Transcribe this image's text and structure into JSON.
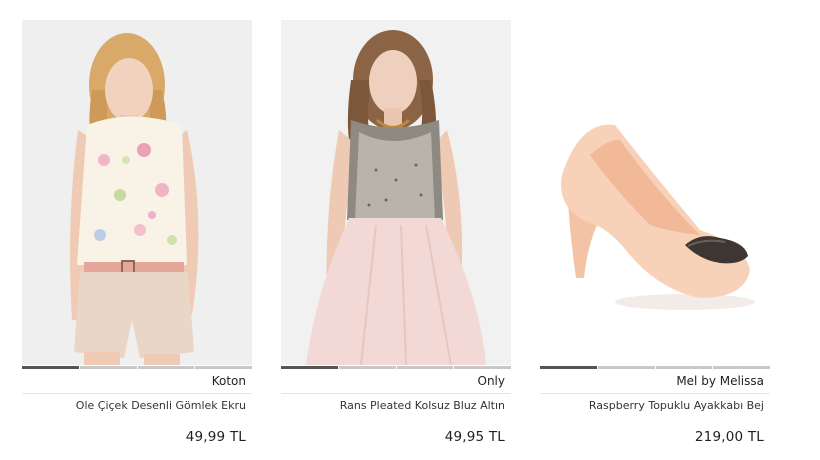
{
  "products": [
    {
      "brand": "Koton",
      "name": "Ole Çiçek Desenli Gömlek Ekru",
      "price": "49,99 TL",
      "image_icon": "product-photo-blouse",
      "active_slide": 1,
      "slide_count": 4
    },
    {
      "brand": "Only",
      "name": "Rans Pleated Kolsuz Bluz Altın",
      "price": "49,95 TL",
      "image_icon": "product-photo-top",
      "active_slide": 1,
      "slide_count": 4
    },
    {
      "brand": "Mel by Melissa",
      "name": "Raspberry Topuklu Ayakkabı Bej",
      "price": "219,00 TL",
      "image_icon": "product-photo-shoe",
      "active_slide": 1,
      "slide_count": 4
    }
  ],
  "colors": {
    "indicator_active": "#555555",
    "indicator_inactive": "#c8c8c8",
    "divider": "#e6e6e6"
  }
}
